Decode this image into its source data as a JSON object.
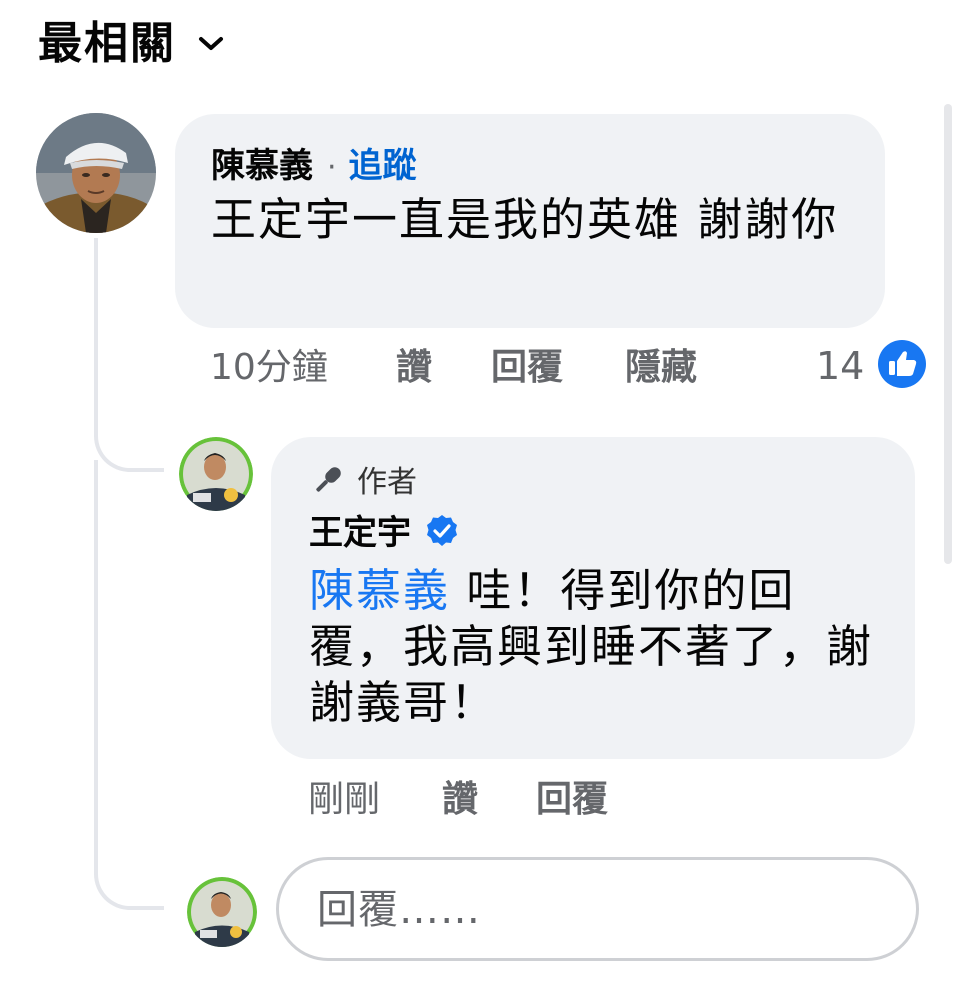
{
  "sort": {
    "label": "最相關",
    "icon": "chevron-down-icon"
  },
  "comment": {
    "author": "陳慕義",
    "separator": "·",
    "follow_label": "追蹤",
    "text": "王定宇一直是我的英雄 謝謝你",
    "timestamp": "10分鐘",
    "actions": {
      "like": "讚",
      "reply": "回覆",
      "hide": "隱藏"
    },
    "reaction_count": "14",
    "reaction_icon": "like-reaction-icon"
  },
  "reply": {
    "badge_label": "作者",
    "badge_icon": "microphone-icon",
    "author": "王定宇",
    "verified_icon": "verified-badge-icon",
    "mention": "陳慕義",
    "text": " 哇！得到你的回覆，我高興到睡不著了，謝謝義哥！",
    "timestamp": "剛剛",
    "actions": {
      "like": "讚",
      "reply": "回覆"
    }
  },
  "composer": {
    "placeholder": "回覆……"
  },
  "colors": {
    "link_blue": "#0064d1",
    "mention_blue": "#1877f2",
    "bubble_bg": "#f0f2f5",
    "secondary_text": "#65676b",
    "like_blue": "#1877f2"
  }
}
